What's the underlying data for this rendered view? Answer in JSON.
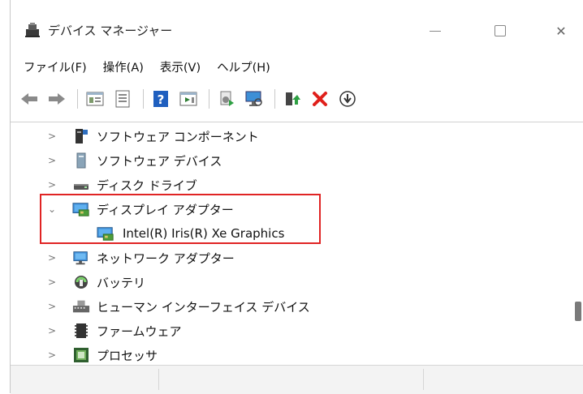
{
  "window": {
    "title": "デバイス マネージャー",
    "controls": {
      "minimize_icon": "minimize-icon",
      "maximize_icon": "maximize-icon",
      "close_glyph": "✕"
    }
  },
  "menu": [
    "ファイル(F)",
    "操作(A)",
    "表示(V)",
    "ヘルプ(H)"
  ],
  "toolbar": {
    "buttons": [
      "back-icon",
      "forward-icon",
      "properties-pane-icon",
      "console-tree-icon",
      "help-icon",
      "run-icon",
      "update-driver-icon",
      "scan-hardware-icon",
      "enable-device-icon",
      "uninstall-icon",
      "download-icon"
    ],
    "accent": {
      "help_blue": "#1f5fbf",
      "uninstall_red": "#e0201b",
      "enable_green": "#2ea043"
    }
  },
  "tree": {
    "items": [
      {
        "label": "ソフトウェア コンポーネント",
        "expanded": false,
        "icon": "software-component-icon"
      },
      {
        "label": "ソフトウェア デバイス",
        "expanded": false,
        "icon": "software-device-icon"
      },
      {
        "label": "ディスク ドライブ",
        "expanded": false,
        "icon": "disk-drive-icon"
      },
      {
        "label": "ディスプレイ アダプター",
        "expanded": true,
        "icon": "display-adapter-icon",
        "children": [
          {
            "label": "Intel(R) Iris(R) Xe Graphics",
            "icon": "display-adapter-icon"
          }
        ]
      },
      {
        "label": "ネットワーク アダプター",
        "expanded": false,
        "icon": "network-adapter-icon"
      },
      {
        "label": "バッテリ",
        "expanded": false,
        "icon": "battery-icon"
      },
      {
        "label": "ヒューマン インターフェイス デバイス",
        "expanded": false,
        "icon": "hid-icon"
      },
      {
        "label": "ファームウェア",
        "expanded": false,
        "icon": "firmware-icon"
      },
      {
        "label": "プロセッサ",
        "expanded": false,
        "icon": "processor-icon"
      }
    ],
    "highlight_color": "#e02424"
  }
}
